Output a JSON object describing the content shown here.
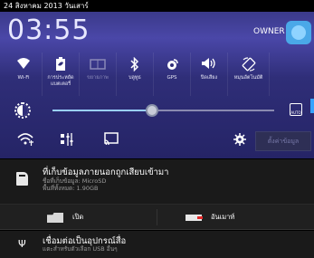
{
  "status_bar": {
    "date": "24 สิงหาคม 2013 วันเสาร์"
  },
  "quick_settings": {
    "time": "03:55",
    "user": "OWNER",
    "tiles": [
      {
        "label": "Wi-Fi",
        "icon": "wifi-icon",
        "state": "on"
      },
      {
        "label": "การประหยัดแบตเตอรี่",
        "icon": "battery-saver-icon",
        "state": "on"
      },
      {
        "label": "ขยายภาพ",
        "icon": "reading-mode-icon",
        "state": "off"
      },
      {
        "label": "บลูทูธ",
        "icon": "bluetooth-icon",
        "state": "on"
      },
      {
        "label": "GPS",
        "icon": "gps-icon",
        "state": "on"
      },
      {
        "label": "ปิดเสียง",
        "icon": "sound-icon",
        "state": "on"
      },
      {
        "label": "หมุนอัตโนมัติ",
        "icon": "auto-rotate-icon",
        "state": "on"
      }
    ],
    "brightness": {
      "level": 0.45,
      "auto_label": "AUTO"
    },
    "settings_label": "ตั้งค่าข้อมูล"
  },
  "notifications": {
    "sd": {
      "title": "ที่เก็บข้อมูลภายนอกถูกเสียบเข้ามา",
      "line1": "ชื่อที่เก็บข้อมูล: MicroSD",
      "line2": "พื้นที่ทั้งหมด: 1.90GB",
      "open_label": "เปิด",
      "unmount_label": "อันเมาท์"
    },
    "usb": {
      "title": "เชื่อมต่อเป็นอุปกรณ์สื่อ",
      "subtitle": "แตะสำหรับตัวเลือก USB อื่นๆ"
    }
  },
  "colors": {
    "accent": "#37a3ff",
    "shade": "#2f2e78"
  }
}
